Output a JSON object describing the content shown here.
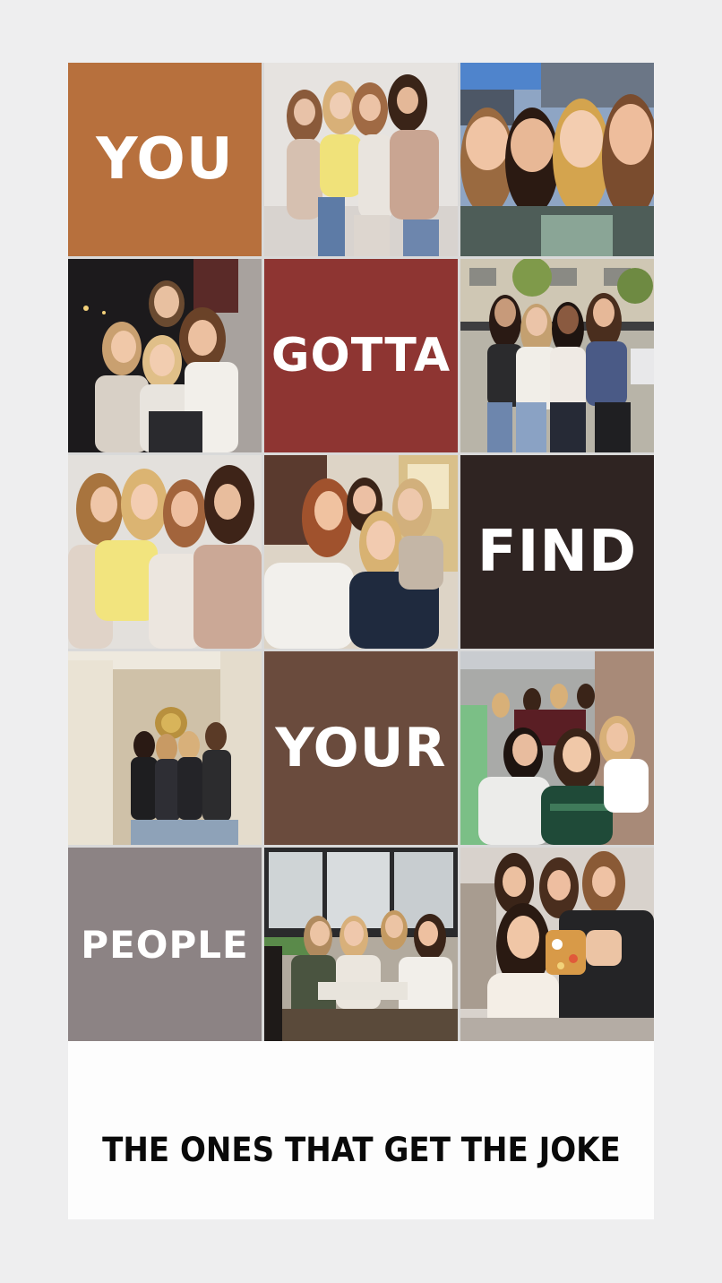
{
  "words": {
    "you": "YOU",
    "gotta": "GOTTA",
    "find": "FIND",
    "your": "YOUR",
    "people": "PEOPLE"
  },
  "tagline": "THE ONES THAT GET THE JOKE",
  "colors": {
    "page_bg": "#eeeeef",
    "you_tile": "#b7703d",
    "gotta_tile": "#8e3532",
    "find_tile": "#2f2422",
    "your_tile": "#6a4b3d",
    "people_tile": "#8c8384",
    "tagline_text": "#0a0a0a"
  },
  "photos": [
    {
      "name": "photo-group-hug-studio",
      "description": "four friends hugging"
    },
    {
      "name": "photo-group-selfie-outdoor",
      "description": "four friends selfie"
    },
    {
      "name": "photo-group-night-street",
      "description": "friends hugging at night"
    },
    {
      "name": "photo-group-street-evening",
      "description": "four friends on street"
    },
    {
      "name": "photo-group-hug-studio-2",
      "description": "four friends hugging"
    },
    {
      "name": "photo-group-indoor-hug",
      "description": "four friends indoors"
    },
    {
      "name": "photo-group-hallway",
      "description": "friends in hallway"
    },
    {
      "name": "photo-group-street-selfie",
      "description": "friends on street"
    },
    {
      "name": "photo-group-cafe-table",
      "description": "friends at cafe table"
    },
    {
      "name": "photo-group-mirror-selfie",
      "description": "mirror selfie"
    }
  ]
}
